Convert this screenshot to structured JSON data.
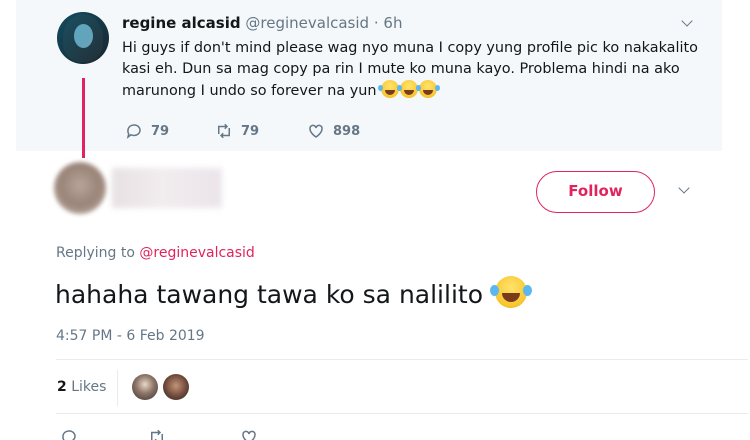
{
  "parent_tweet": {
    "name": "regine alcasid",
    "handle": "@reginevalcasid",
    "time": "6h",
    "text": "Hi guys if don't mind please wag nyo muna I copy yung profile pic ko nakakalito kasi eh. Dun sa mag copy pa rin I mute ko muna kayo. Problema hindi na ako marunong I undo so forever na yun",
    "emoji": "face-with-tears-of-joy",
    "reply_count": "79",
    "retweet_count": "79",
    "like_count": "898",
    "accent_color": "#e0245e"
  },
  "reply": {
    "follow_label": "Follow",
    "replying_prefix": "Replying to",
    "replying_handle": "@reginevalcasid",
    "text": "hahaha tawang tawa ko sa nalilito",
    "emoji": "face-with-tears-of-joy",
    "timestamp": "4:57 PM - 6 Feb 2019",
    "likes_count": "2",
    "likes_label": "Likes"
  },
  "icons": {
    "reply": "reply-icon",
    "retweet": "retweet-icon",
    "like": "heart-icon",
    "more": "chevron-down-icon"
  }
}
